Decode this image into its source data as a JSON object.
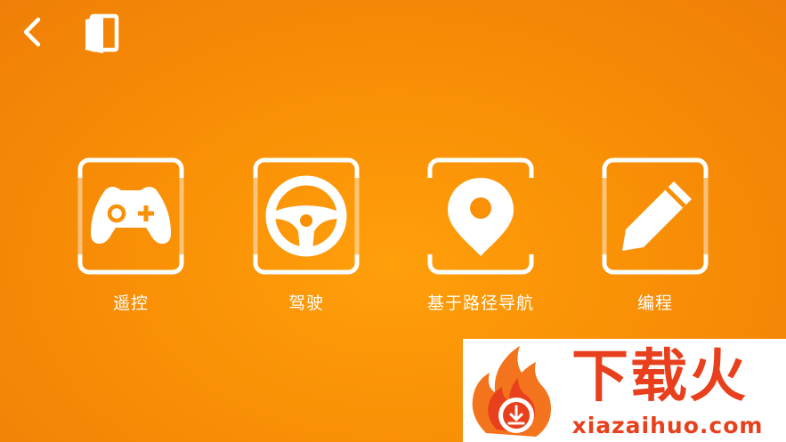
{
  "toolbar": {
    "back_icon": "chevron-left-icon",
    "book_icon": "book-icon"
  },
  "modes": [
    {
      "label": "遥控",
      "icon": "gamepad-icon"
    },
    {
      "label": "驾驶",
      "icon": "steering-wheel-icon"
    },
    {
      "label": "基于路径导航",
      "icon": "map-pin-icon"
    },
    {
      "label": "编程",
      "icon": "pencil-icon"
    }
  ],
  "watermark": {
    "title": "下载火",
    "url": "xiazaihuo.com"
  },
  "colors": {
    "background": "#f99006",
    "foreground": "#ffffff",
    "watermark_accent": "#e8401c"
  }
}
